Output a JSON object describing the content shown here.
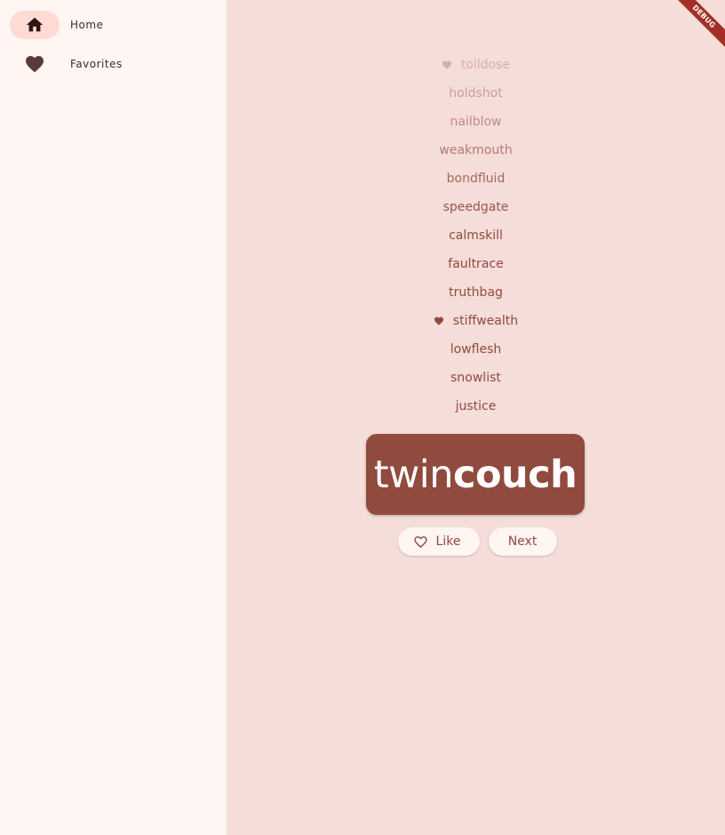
{
  "nav": {
    "items": [
      {
        "label": "Home",
        "icon": "home-icon",
        "selected": true
      },
      {
        "label": "Favorites",
        "icon": "heart-icon",
        "selected": false
      }
    ]
  },
  "history": [
    {
      "word": "tolldose",
      "favorite": true
    },
    {
      "word": "holdshot",
      "favorite": false
    },
    {
      "word": "nailblow",
      "favorite": false
    },
    {
      "word": "weakmouth",
      "favorite": false
    },
    {
      "word": "bondfluid",
      "favorite": false
    },
    {
      "word": "speedgate",
      "favorite": false
    },
    {
      "word": "calmskill",
      "favorite": false
    },
    {
      "word": "faultrace",
      "favorite": false
    },
    {
      "word": "truthbag",
      "favorite": false
    },
    {
      "word": "stiffwealth",
      "favorite": true
    },
    {
      "word": "lowflesh",
      "favorite": false
    },
    {
      "word": "snowlist",
      "favorite": false
    },
    {
      "word": "justice",
      "favorite": false
    }
  ],
  "current": {
    "first": "twin",
    "second": "couch"
  },
  "actions": {
    "like_label": "Like",
    "next_label": "Next"
  },
  "debug_banner": "DEBUG",
  "colors": {
    "primary": "#904a3e",
    "rail_bg": "#fff5f3",
    "main_bg": "#f5ddd9",
    "indicator": "#ffdbd3"
  }
}
